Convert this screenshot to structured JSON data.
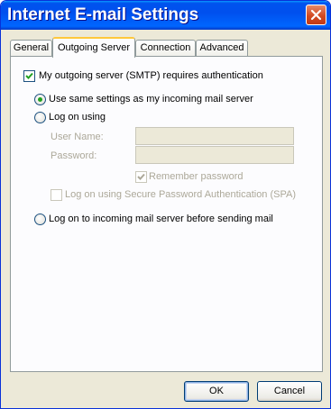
{
  "window": {
    "title": "Internet E-mail Settings"
  },
  "tabs": [
    {
      "label": "General"
    },
    {
      "label": "Outgoing Server"
    },
    {
      "label": "Connection"
    },
    {
      "label": "Advanced"
    }
  ],
  "outgoing": {
    "smtp_auth_label": "My outgoing server (SMTP) requires authentication",
    "smtp_auth_checked": true,
    "use_same_label": "Use same settings as my incoming mail server",
    "log_on_using_label": "Log on using",
    "username_label": "User Name:",
    "username_value": "",
    "password_label": "Password:",
    "password_value": "",
    "remember_label": "Remember password",
    "spa_label": "Log on using Secure Password Authentication (SPA)",
    "log_on_incoming_label": "Log on to incoming mail server before sending mail",
    "selected_option": "use_same"
  },
  "buttons": {
    "ok": "OK",
    "cancel": "Cancel"
  },
  "colors": {
    "titlebar": "#0053ee",
    "dialog_bg": "#ece9d8",
    "active_tab_highlight": "#ffc83c",
    "radio_dot": "#21a121"
  }
}
